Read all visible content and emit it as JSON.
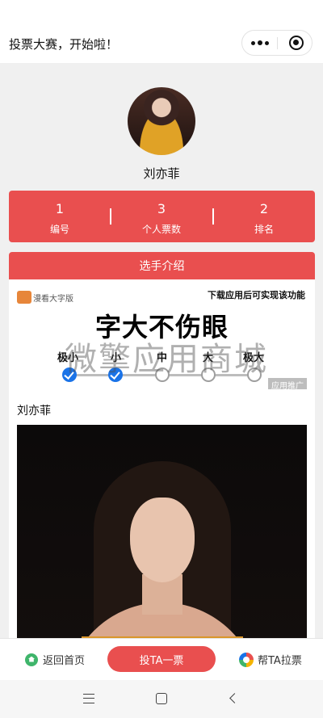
{
  "header": {
    "title": "投票大赛，开始啦！",
    "more_icon": "more-dots-icon",
    "close_icon": "target-circle-icon"
  },
  "profile": {
    "name": "刘亦菲"
  },
  "stats": [
    {
      "value": "1",
      "label": "编号"
    },
    {
      "value": "3",
      "label": "个人票数"
    },
    {
      "value": "2",
      "label": "排名"
    }
  ],
  "intro": {
    "title": "选手介绍"
  },
  "ad": {
    "app_name": "漫看大字版",
    "download_text": "下载应用后可实现该功能",
    "headline": "字大不伤眼",
    "levels": [
      "极小",
      "小",
      "中",
      "大",
      "极大"
    ],
    "selected_level": "小",
    "tag": "应用推广",
    "watermark": "微擎应用商城"
  },
  "content": {
    "name": "刘亦菲"
  },
  "footer": {
    "home_label": "返回首页",
    "vote_label": "投TA一票",
    "help_label": "帮TA拉票"
  },
  "colors": {
    "accent": "#e94f4f",
    "home_icon": "#3fb56b",
    "check_blue": "#1a73e8"
  }
}
